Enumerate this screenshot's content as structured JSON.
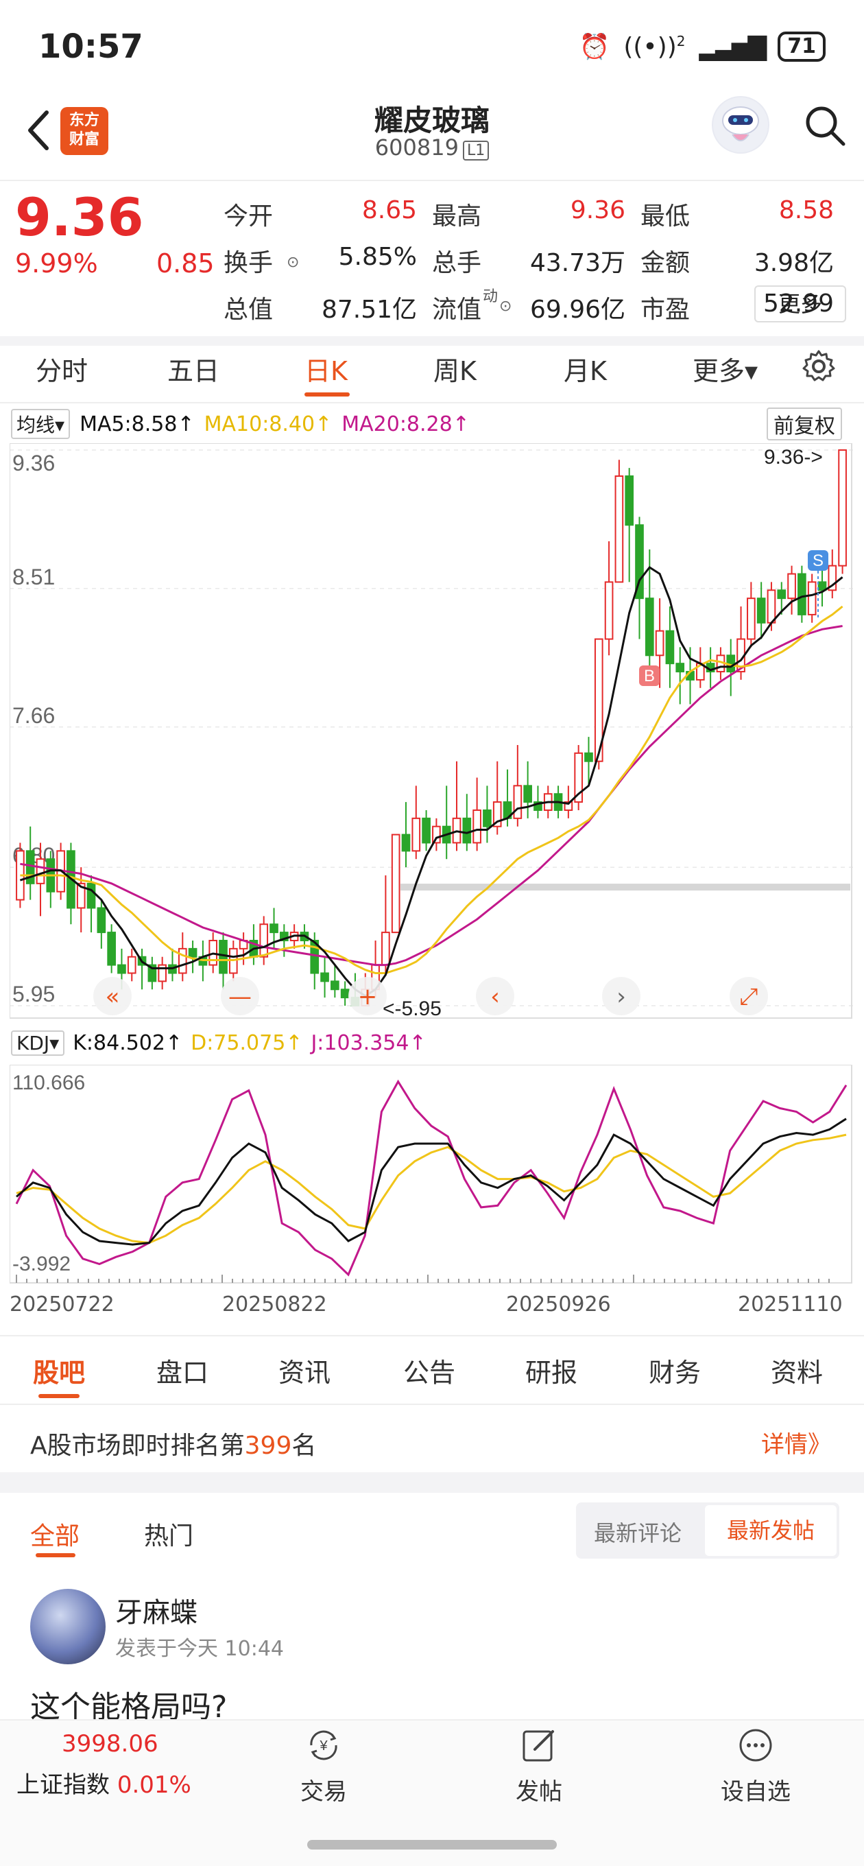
{
  "status_bar": {
    "time": "10:57",
    "signal_label": "2",
    "battery": "71"
  },
  "header": {
    "logo_line1": "东方",
    "logo_line2": "财富",
    "title": "耀皮玻璃",
    "code": "600819",
    "level": "L1"
  },
  "quote": {
    "price": "9.36",
    "change_pct": "9.99%",
    "change": "0.85",
    "rows": [
      [
        {
          "label": "今开",
          "value": "8.65",
          "red": true
        },
        {
          "label": "最高",
          "value": "9.36",
          "red": true
        },
        {
          "label": "最低",
          "value": "8.58",
          "red": true
        }
      ],
      [
        {
          "label": "换手",
          "value": "5.85%",
          "red": false
        },
        {
          "label": "总手",
          "value": "43.73万",
          "red": false
        },
        {
          "label": "金额",
          "value": "3.98亿",
          "red": false
        }
      ],
      [
        {
          "label": "总值",
          "value": "87.51亿",
          "red": false
        },
        {
          "label": "流值",
          "value": "69.96亿",
          "red": false
        },
        {
          "label": "市盈",
          "value": "52.99",
          "red": false
        }
      ]
    ],
    "pe_superscript": "动",
    "more_button": "更多"
  },
  "period_tabs": [
    "分时",
    "五日",
    "日K",
    "周K",
    "月K",
    "更多▾"
  ],
  "active_period": 2,
  "ma_legend": {
    "selector": "均线▾",
    "ma5": "MA5:8.58↑",
    "ma10": "MA10:8.40↑",
    "ma20": "MA20:8.28↑",
    "adjust": "前复权"
  },
  "chart_data": [
    {
      "type": "candlestick",
      "y_ticks": [
        "9.36",
        "8.51",
        "7.66",
        "6.80",
        "5.95"
      ],
      "ylim": [
        5.95,
        9.36
      ],
      "annotations": {
        "high": "9.36->",
        "low": "<-5.95",
        "buy_marker": "B",
        "sell_marker": "S"
      },
      "colors": {
        "up": "#e52a2a",
        "down": "#2aa52a",
        "ma5": "#111111",
        "ma10": "#f0c419",
        "ma20": "#c2188b"
      },
      "candles": [
        [
          6.6,
          6.9,
          6.55,
          6.95
        ],
        [
          6.9,
          6.7,
          6.6,
          7.05
        ],
        [
          6.7,
          6.85,
          6.5,
          6.95
        ],
        [
          6.85,
          6.65,
          6.55,
          6.9
        ],
        [
          6.65,
          6.9,
          6.6,
          6.95
        ],
        [
          6.9,
          6.55,
          6.45,
          6.95
        ],
        [
          6.55,
          6.7,
          6.4,
          6.8
        ],
        [
          6.7,
          6.55,
          6.4,
          6.75
        ],
        [
          6.55,
          6.4,
          6.3,
          6.6
        ],
        [
          6.4,
          6.2,
          6.15,
          6.45
        ],
        [
          6.2,
          6.15,
          6.05,
          6.3
        ],
        [
          6.15,
          6.25,
          6.1,
          6.3
        ],
        [
          6.25,
          6.2,
          6.05,
          6.3
        ],
        [
          6.2,
          6.1,
          6.05,
          6.25
        ],
        [
          6.1,
          6.2,
          6.05,
          6.25
        ],
        [
          6.2,
          6.15,
          6.1,
          6.3
        ],
        [
          6.15,
          6.3,
          6.1,
          6.4
        ],
        [
          6.3,
          6.25,
          6.15,
          6.35
        ],
        [
          6.25,
          6.2,
          6.1,
          6.35
        ],
        [
          6.2,
          6.35,
          6.15,
          6.4
        ],
        [
          6.35,
          6.15,
          6.05,
          6.4
        ],
        [
          6.15,
          6.3,
          6.1,
          6.35
        ],
        [
          6.3,
          6.35,
          6.2,
          6.4
        ],
        [
          6.35,
          6.25,
          6.2,
          6.45
        ],
        [
          6.25,
          6.45,
          6.2,
          6.5
        ],
        [
          6.45,
          6.4,
          6.3,
          6.55
        ],
        [
          6.4,
          6.35,
          6.25,
          6.45
        ],
        [
          6.35,
          6.4,
          6.3,
          6.45
        ],
        [
          6.4,
          6.35,
          6.3,
          6.45
        ],
        [
          6.35,
          6.15,
          6.05,
          6.4
        ],
        [
          6.15,
          6.1,
          6.0,
          6.25
        ],
        [
          6.1,
          6.05,
          6.0,
          6.2
        ],
        [
          6.05,
          6.0,
          5.95,
          6.1
        ],
        [
          6.0,
          5.95,
          5.95,
          6.15
        ],
        [
          5.95,
          6.05,
          5.95,
          6.15
        ],
        [
          6.05,
          6.2,
          6.0,
          6.35
        ],
        [
          6.2,
          6.4,
          6.15,
          6.75
        ],
        [
          6.4,
          7.0,
          6.4,
          7.0
        ],
        [
          7.0,
          6.9,
          6.8,
          7.2
        ],
        [
          6.9,
          7.1,
          6.85,
          7.3
        ],
        [
          7.1,
          6.95,
          6.9,
          7.15
        ],
        [
          6.95,
          7.05,
          6.9,
          7.1
        ],
        [
          7.05,
          6.95,
          6.85,
          7.3
        ],
        [
          6.95,
          7.1,
          6.9,
          7.45
        ],
        [
          7.1,
          6.95,
          6.9,
          7.25
        ],
        [
          6.95,
          7.15,
          6.9,
          7.35
        ],
        [
          7.15,
          7.05,
          6.95,
          7.3
        ],
        [
          7.05,
          7.2,
          7.0,
          7.45
        ],
        [
          7.2,
          7.1,
          7.05,
          7.4
        ],
        [
          7.1,
          7.3,
          7.05,
          7.55
        ],
        [
          7.3,
          7.2,
          7.1,
          7.45
        ],
        [
          7.2,
          7.15,
          7.1,
          7.3
        ],
        [
          7.15,
          7.25,
          7.1,
          7.3
        ],
        [
          7.25,
          7.15,
          7.1,
          7.3
        ],
        [
          7.15,
          7.2,
          7.1,
          7.3
        ],
        [
          7.2,
          7.5,
          7.15,
          7.55
        ],
        [
          7.5,
          7.45,
          7.3,
          7.6
        ],
        [
          7.45,
          8.2,
          7.4,
          8.2
        ],
        [
          8.2,
          8.55,
          8.1,
          8.8
        ],
        [
          8.55,
          9.2,
          8.55,
          9.3
        ],
        [
          9.2,
          8.9,
          8.55,
          9.25
        ],
        [
          8.9,
          8.45,
          8.2,
          8.95
        ],
        [
          8.45,
          8.1,
          7.95,
          8.75
        ],
        [
          8.1,
          8.25,
          7.9,
          8.45
        ],
        [
          8.25,
          8.05,
          7.9,
          8.4
        ],
        [
          8.05,
          8.0,
          7.8,
          8.15
        ],
        [
          8.0,
          7.95,
          7.8,
          8.15
        ],
        [
          7.95,
          8.05,
          7.9,
          8.15
        ],
        [
          8.05,
          8.0,
          7.9,
          8.15
        ],
        [
          8.0,
          8.1,
          7.95,
          8.15
        ],
        [
          8.1,
          8.0,
          7.85,
          8.2
        ],
        [
          8.0,
          8.2,
          7.95,
          8.4
        ],
        [
          8.2,
          8.45,
          8.15,
          8.55
        ],
        [
          8.45,
          8.3,
          8.2,
          8.55
        ],
        [
          8.3,
          8.5,
          8.25,
          8.55
        ],
        [
          8.5,
          8.45,
          8.35,
          8.55
        ],
        [
          8.45,
          8.6,
          8.35,
          8.65
        ],
        [
          8.6,
          8.35,
          8.3,
          8.65
        ],
        [
          8.35,
          8.55,
          8.3,
          8.6
        ],
        [
          8.55,
          8.5,
          8.4,
          8.65
        ],
        [
          8.5,
          8.65,
          8.45,
          8.75
        ],
        [
          8.65,
          9.36,
          8.6,
          9.36
        ]
      ],
      "ma5": [
        6.72,
        6.74,
        6.76,
        6.78,
        6.78,
        6.73,
        6.68,
        6.66,
        6.6,
        6.5,
        6.42,
        6.32,
        6.22,
        6.18,
        6.18,
        6.18,
        6.2,
        6.22,
        6.25,
        6.27,
        6.26,
        6.25,
        6.26,
        6.3,
        6.31,
        6.34,
        6.36,
        6.38,
        6.38,
        6.34,
        6.28,
        6.2,
        6.12,
        6.05,
        6.01,
        6.05,
        6.14,
        6.33,
        6.51,
        6.7,
        6.87,
        6.98,
        7.0,
        7.02,
        7.01,
        7.03,
        7.03,
        7.08,
        7.1,
        7.16,
        7.17,
        7.19,
        7.2,
        7.2,
        7.19,
        7.25,
        7.3,
        7.5,
        7.74,
        8.05,
        8.36,
        8.56,
        8.64,
        8.6,
        8.44,
        8.19,
        8.08,
        8.05,
        8.01,
        8.03,
        8.03,
        8.07,
        8.16,
        8.21,
        8.3,
        8.37,
        8.43,
        8.46,
        8.47,
        8.49,
        8.53,
        8.58
      ],
      "ma10": [
        6.75,
        6.75,
        6.75,
        6.75,
        6.75,
        6.74,
        6.72,
        6.71,
        6.69,
        6.63,
        6.57,
        6.52,
        6.46,
        6.4,
        6.34,
        6.29,
        6.26,
        6.24,
        6.23,
        6.23,
        6.23,
        6.23,
        6.24,
        6.25,
        6.26,
        6.28,
        6.3,
        6.31,
        6.32,
        6.31,
        6.29,
        6.27,
        6.24,
        6.2,
        6.17,
        6.15,
        6.15,
        6.17,
        6.19,
        6.22,
        6.27,
        6.34,
        6.42,
        6.49,
        6.56,
        6.62,
        6.67,
        6.73,
        6.79,
        6.85,
        6.89,
        6.92,
        6.95,
        6.98,
        7.02,
        7.05,
        7.09,
        7.16,
        7.24,
        7.33,
        7.41,
        7.5,
        7.6,
        7.72,
        7.84,
        7.93,
        8.0,
        8.04,
        8.07,
        8.06,
        8.04,
        8.03,
        8.04,
        8.06,
        8.09,
        8.12,
        8.16,
        8.21,
        8.26,
        8.31,
        8.35,
        8.4
      ],
      "ma20": [
        6.82,
        6.81,
        6.8,
        6.79,
        6.78,
        6.77,
        6.76,
        6.74,
        6.72,
        6.7,
        6.67,
        6.64,
        6.61,
        6.58,
        6.55,
        6.52,
        6.49,
        6.46,
        6.43,
        6.41,
        6.39,
        6.37,
        6.35,
        6.33,
        6.31,
        6.3,
        6.29,
        6.28,
        6.27,
        6.26,
        6.25,
        6.24,
        6.23,
        6.22,
        6.21,
        6.2,
        6.2,
        6.21,
        6.23,
        6.26,
        6.29,
        6.32,
        6.36,
        6.4,
        6.44,
        6.48,
        6.53,
        6.58,
        6.63,
        6.68,
        6.73,
        6.78,
        6.84,
        6.9,
        6.96,
        7.02,
        7.08,
        7.16,
        7.24,
        7.32,
        7.4,
        7.47,
        7.54,
        7.6,
        7.66,
        7.72,
        7.78,
        7.84,
        7.89,
        7.94,
        7.98,
        8.02,
        8.06,
        8.1,
        8.13,
        8.16,
        8.19,
        8.22,
        8.24,
        8.26,
        8.27,
        8.28
      ]
    },
    {
      "type": "line",
      "name": "KDJ",
      "y_ticks": [
        "110.666",
        "-3.992"
      ],
      "ylim": [
        -3.992,
        110.666
      ],
      "x_labels": [
        "20250722",
        "20250822",
        "20250926",
        "20251110"
      ],
      "series": [
        {
          "name": "K",
          "color": "#111111",
          "values": [
            40,
            48,
            45,
            30,
            20,
            15,
            14,
            13,
            14,
            25,
            32,
            35,
            48,
            62,
            70,
            65,
            45,
            38,
            30,
            25,
            15,
            20,
            55,
            68,
            70,
            70,
            70,
            58,
            48,
            45,
            50,
            52,
            46,
            38,
            48,
            58,
            75,
            70,
            60,
            50,
            45,
            40,
            35,
            50,
            60,
            70,
            74,
            76,
            75,
            78,
            84
          ]
        },
        {
          "name": "D",
          "color": "#f0c419",
          "values": [
            42,
            45,
            44,
            36,
            28,
            22,
            18,
            15,
            14,
            18,
            24,
            28,
            36,
            45,
            55,
            60,
            55,
            48,
            40,
            33,
            24,
            22,
            38,
            52,
            60,
            65,
            68,
            62,
            55,
            50,
            50,
            51,
            48,
            43,
            45,
            50,
            62,
            66,
            64,
            58,
            52,
            46,
            40,
            42,
            50,
            58,
            66,
            70,
            72,
            73,
            75
          ]
        },
        {
          "name": "J",
          "color": "#c2188b",
          "values": [
            36,
            55,
            46,
            18,
            5,
            2,
            6,
            9,
            14,
            40,
            48,
            50,
            72,
            95,
            100,
            75,
            25,
            20,
            10,
            5,
            -4,
            18,
            88,
            105,
            90,
            80,
            74,
            50,
            34,
            35,
            48,
            55,
            42,
            28,
            54,
            75,
            101,
            78,
            52,
            34,
            32,
            28,
            25,
            66,
            80,
            94,
            90,
            88,
            82,
            88,
            103
          ]
        }
      ],
      "legend": {
        "k": "K:84.502↑",
        "d": "D:75.075↑",
        "j": "J:103.354↑",
        "selector": "KDJ▾"
      }
    }
  ],
  "section_tabs": [
    "股吧",
    "盘口",
    "资讯",
    "公告",
    "研报",
    "财务",
    "资料"
  ],
  "rank": {
    "prefix": "A股市场即时排名第",
    "number": "399",
    "suffix": "名",
    "detail": "详情》"
  },
  "feed": {
    "tabs": [
      "全部",
      "热门"
    ],
    "sort_options": [
      "最新评论",
      "最新发帖"
    ],
    "post": {
      "user": "牙麻蝶",
      "time": "发表于今天 10:44",
      "text": "这个能格局吗?"
    }
  },
  "bottom_bar": {
    "index_value": "3998.06",
    "index_name": "上证指数",
    "index_pct": "0.01%",
    "trade": "交易",
    "post": "发帖",
    "add_watch": "设自选"
  }
}
